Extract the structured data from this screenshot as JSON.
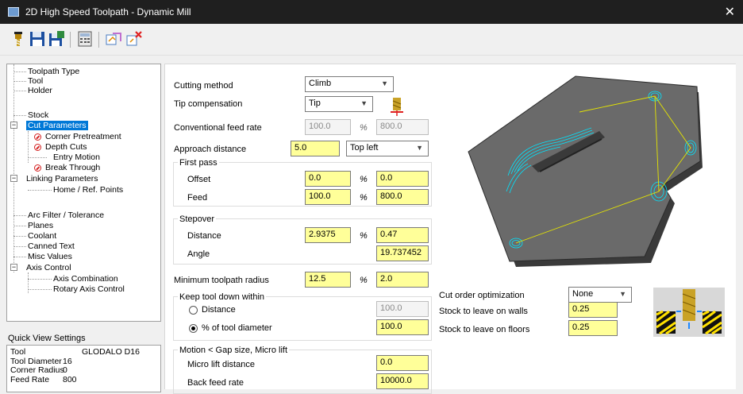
{
  "window": {
    "title": "2D High Speed Toolpath - Dynamic Mill",
    "close": "✕"
  },
  "toolbar": {
    "icons": [
      "tool-icon",
      "save-icon",
      "save-as-icon",
      "calculator-icon",
      "view-icon",
      "delete-icon"
    ]
  },
  "tree": {
    "items": [
      {
        "label": "Toolpath Type"
      },
      {
        "label": "Tool"
      },
      {
        "label": "Holder"
      },
      {
        "label": "Stock"
      },
      {
        "label": "Cut Parameters",
        "selected": true
      },
      {
        "label": "Corner Pretreatment",
        "disabled": true
      },
      {
        "label": "Depth Cuts",
        "disabled": true
      },
      {
        "label": "Entry Motion"
      },
      {
        "label": "Break Through",
        "disabled": true
      },
      {
        "label": "Linking Parameters"
      },
      {
        "label": "Home / Ref. Points"
      },
      {
        "label": "Arc Filter / Tolerance"
      },
      {
        "label": "Planes"
      },
      {
        "label": "Coolant"
      },
      {
        "label": "Canned Text"
      },
      {
        "label": "Misc Values"
      },
      {
        "label": "Axis Control"
      },
      {
        "label": "Axis Combination"
      },
      {
        "label": "Rotary Axis Control"
      }
    ]
  },
  "quick_view": {
    "title": "Quick View Settings",
    "rows": [
      {
        "key": "Tool",
        "value": "GLODALO D16"
      },
      {
        "key": "Tool Diameter",
        "value": "16"
      },
      {
        "key": "Corner Radius",
        "value": "0"
      },
      {
        "key": "Feed Rate",
        "value": "800"
      }
    ]
  },
  "params": {
    "cutting_method": {
      "label": "Cutting method",
      "value": "Climb"
    },
    "tip_compensation": {
      "label": "Tip compensation",
      "value": "Tip"
    },
    "conventional_feed": {
      "label": "Conventional feed rate",
      "value": "100.0",
      "value2": "800.0"
    },
    "approach_distance": {
      "label": "Approach distance",
      "value": "5.0",
      "position": "Top left"
    },
    "first_pass": {
      "title": "First pass",
      "offset_label": "Offset",
      "offset": "0.0",
      "offset2": "0.0",
      "feed_label": "Feed",
      "feed": "100.0",
      "feed2": "800.0"
    },
    "stepover": {
      "title": "Stepover",
      "distance_label": "Distance",
      "distance": "2.9375",
      "distance2": "0.47",
      "angle_label": "Angle",
      "angle": "19.737452"
    },
    "min_radius": {
      "label": "Minimum toolpath radius",
      "value": "12.5",
      "value2": "2.0"
    },
    "keep_tool_down": {
      "title": "Keep tool down within",
      "distance_label": "Distance",
      "distance": "100.0",
      "percent_label": "% of tool diameter",
      "percent": "100.0",
      "selected": "percent"
    },
    "micro_lift": {
      "title": "Motion < Gap size, Micro lift",
      "distance_label": "Micro lift distance",
      "distance": "0.0",
      "back_feed_label": "Back feed rate",
      "back_feed": "10000.0"
    },
    "percent_symbol": "%",
    "cut_order": {
      "label": "Cut order optimization",
      "value": "None"
    },
    "stock_walls": {
      "label": "Stock to leave on walls",
      "value": "0.25"
    },
    "stock_floors": {
      "label": "Stock to leave on floors",
      "value": "0.25"
    }
  },
  "colors": {
    "field_yellow": "#ffff99",
    "selection": "#0078d7",
    "toolpath": "#00e5ff",
    "path_line": "#e6e600"
  }
}
